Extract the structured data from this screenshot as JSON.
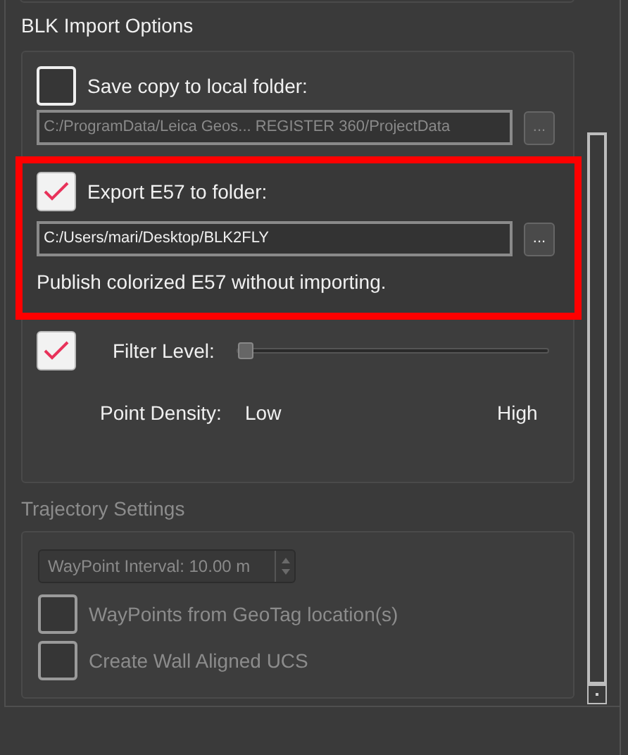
{
  "blk_import_options": {
    "title": "BLK Import Options",
    "save_copy": {
      "label": "Save copy to local folder:",
      "checked": false,
      "path": "C:/ProgramData/Leica Geos... REGISTER 360/ProjectData",
      "path_disabled": true,
      "browse": "..."
    },
    "export_e57": {
      "label": "Export E57 to folder:",
      "checked": true,
      "path": "C:/Users/mari/Desktop/BLK2FLY",
      "browse": "...",
      "note": "Publish colorized E57 without importing.",
      "highlighted": true
    },
    "filter": {
      "checked": true,
      "label": "Filter Level:",
      "level": 0
    },
    "point_density": {
      "label": "Point Density:",
      "low": "Low",
      "high": "High"
    }
  },
  "trajectory_settings": {
    "title": "Trajectory Settings",
    "disabled": true,
    "waypoint_interval": {
      "value": "WayPoint Interval: 10.00 m"
    },
    "options": [
      {
        "label": "WayPoints from GeoTag location(s)",
        "checked": false
      },
      {
        "label": "Create Wall Aligned UCS",
        "checked": false
      }
    ]
  }
}
